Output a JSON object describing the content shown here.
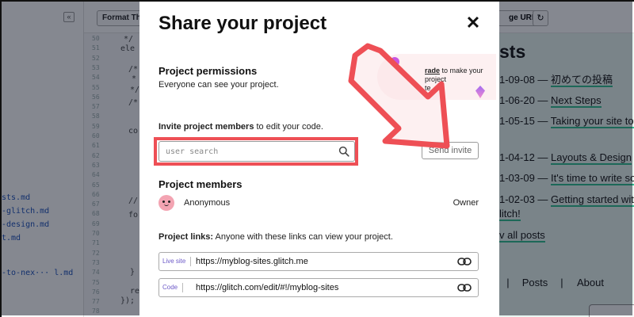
{
  "background": {
    "files": {
      "collapse_icon": "«",
      "items": [
        "sts.md",
        "-glitch.md",
        "-design.md",
        "t.md",
        "-to-nex··· l.md"
      ]
    },
    "editor": {
      "format_label": "Format Th",
      "line_numbers": [
        "50",
        "51",
        "52",
        "53",
        "54",
        "55",
        "56",
        "57",
        "58",
        "59",
        "60",
        "61",
        "62",
        "63",
        "64",
        "65",
        "66",
        "67",
        "68",
        "69",
        "70",
        "71",
        "72",
        "73",
        "74",
        "75",
        "76",
        "77",
        "78"
      ],
      "code_lines": [
        "*/",
        "ele",
        "/*",
        "*",
        "*/",
        "/*",
        "co",
        "//",
        "fo",
        "}",
        "re",
        "});"
      ]
    },
    "preview": {
      "change_url_label": "ge URL",
      "refresh_icon": "↻",
      "heading": "sts",
      "posts": [
        {
          "date": "1-09-08 — ",
          "title": "初めての投稿"
        },
        {
          "date": "1-06-20 — ",
          "title": "Next Steps"
        },
        {
          "date": "1-05-15 — ",
          "title": "Taking your site to th"
        },
        {
          "date": "1-04-12 — ",
          "title": "Layouts & Design"
        },
        {
          "date": "1-03-09 — ",
          "title": "It's time to write som"
        },
        {
          "date": "1-02-03 — ",
          "title": "Getting started with"
        },
        {
          "date": "",
          "title": "litch!"
        }
      ],
      "view_all": "v all posts",
      "nav": [
        "|",
        "Posts",
        "|",
        "About"
      ]
    }
  },
  "modal": {
    "title": "Share your project",
    "close_icon": "✕",
    "permissions": {
      "heading": "Project permissions",
      "text": "Everyone can see your project."
    },
    "upsell": {
      "link": "rade",
      "text": " to make your project",
      "text2": "te."
    },
    "invite": {
      "label_bold": "Invite project members",
      "label_rest": " to edit your code.",
      "placeholder": "user search",
      "send_label": "Send invite"
    },
    "members": {
      "heading": "Project members",
      "list": [
        {
          "name": "Anonymous",
          "role": "Owner"
        }
      ]
    },
    "links": {
      "label_bold": "Project links:",
      "label_rest": " Anyone with these links can view your project.",
      "items": [
        {
          "tag": "Live site",
          "url": "https://myblog-sites.glitch.me"
        },
        {
          "tag": "Code",
          "url": "https://glitch.com/edit/#!/myblog-sites"
        }
      ]
    }
  },
  "colors": {
    "highlight_red": "#ee4f55",
    "accent_green": "#2fbf8f",
    "avatar_pink": "#f3a4b2",
    "tag_purple": "#6d5ac8"
  }
}
